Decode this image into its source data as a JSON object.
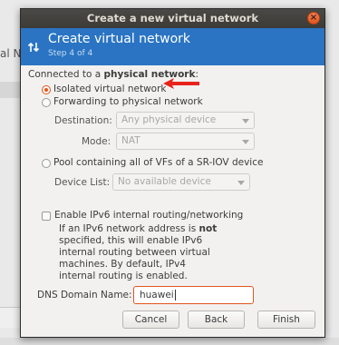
{
  "background": {
    "left_fragment_text": "al N"
  },
  "dialog": {
    "title": "Create a new virtual network",
    "close_glyph": "×",
    "header": {
      "title": "Create virtual network",
      "step": "Step 4 of 4",
      "icon": "network-arrows-icon"
    },
    "connected_prefix": "Connected to a ",
    "connected_bold": "physical network",
    "connected_suffix": ":",
    "options": {
      "isolated": {
        "label": "Isolated virtual network",
        "checked": true
      },
      "forwarding": {
        "label": "Forwarding to physical network",
        "checked": false
      },
      "pool": {
        "label": "Pool containing all of VFs of a SR-IOV device",
        "checked": false
      }
    },
    "destination": {
      "label": "Destination:",
      "value": "Any physical device"
    },
    "mode": {
      "label": "Mode:",
      "value": "NAT"
    },
    "device_list": {
      "label": "Device List:",
      "value": "No available device"
    },
    "ipv6": {
      "label": "Enable IPv6 internal routing/networking",
      "checked": false,
      "desc_line1_pre": "If an IPv6 network address is ",
      "desc_line1_bold": "not",
      "desc_line2": "specified, this will enable IPv6",
      "desc_line3": "internal routing between virtual",
      "desc_line4": "machines. By default, IPv4",
      "desc_line5": "internal routing is enabled."
    },
    "dns": {
      "label": "DNS Domain Name:",
      "value": "huawei"
    },
    "buttons": {
      "cancel": "Cancel",
      "back": "Back",
      "finish": "Finish"
    }
  },
  "colors": {
    "header_blue": "#2a74c3",
    "accent_orange": "#e2561c",
    "annotation_red": "#e8231b"
  }
}
